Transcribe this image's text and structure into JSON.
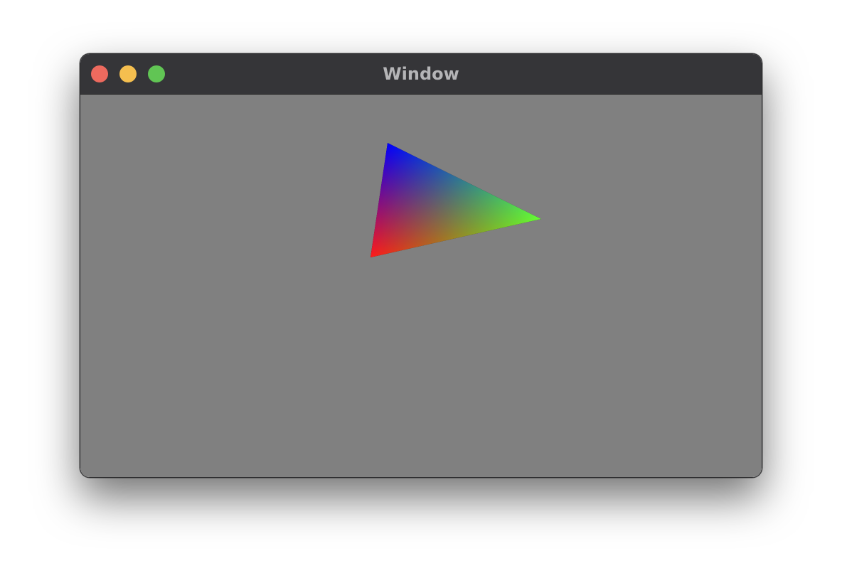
{
  "window": {
    "title": "Window",
    "content_background": "#808080",
    "buttons": {
      "close": {
        "icon": "close-icon",
        "color": "#ed6a5e"
      },
      "minimize": {
        "icon": "minimize-icon",
        "color": "#f5bf4f"
      },
      "zoom": {
        "icon": "zoom-icon",
        "color": "#61c554"
      }
    }
  },
  "triangle": {
    "vertex_colors": {
      "top": "#0000ff",
      "right": "#66ff33",
      "bottom_left": "#ff1a1a"
    }
  }
}
